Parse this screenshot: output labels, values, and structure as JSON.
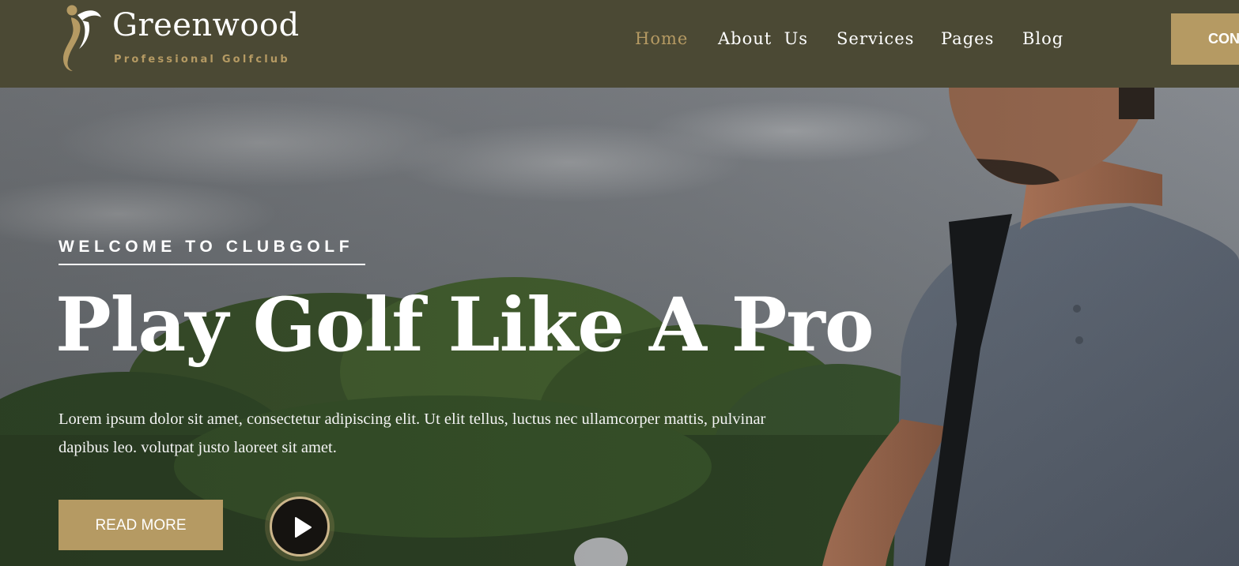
{
  "brand": {
    "name": "Greenwood",
    "tagline": "Professional Golfclub",
    "logo_icon": "golfer-swing-icon",
    "accent_color": "#b59a63",
    "header_color": "#4b4934"
  },
  "nav": {
    "items": [
      {
        "label": "Home",
        "active": true
      },
      {
        "label": "About  Us",
        "active": false
      },
      {
        "label": "Services",
        "active": false
      },
      {
        "label": "Pages",
        "active": false
      },
      {
        "label": "Blog",
        "active": false
      }
    ],
    "contact_label": "CON"
  },
  "hero": {
    "eyebrow": "WELCOME TO CLUBGOLF",
    "headline": "Play Golf Like A Pro",
    "lead": "Lorem ipsum dolor sit amet, consectetur adipiscing elit. Ut elit tellus, luctus nec ullamcorper mattis, pulvinar dapibus leo. volutpat justo laoreet sit amet.",
    "cta_label": "READ MORE",
    "play_icon": "play-icon"
  }
}
